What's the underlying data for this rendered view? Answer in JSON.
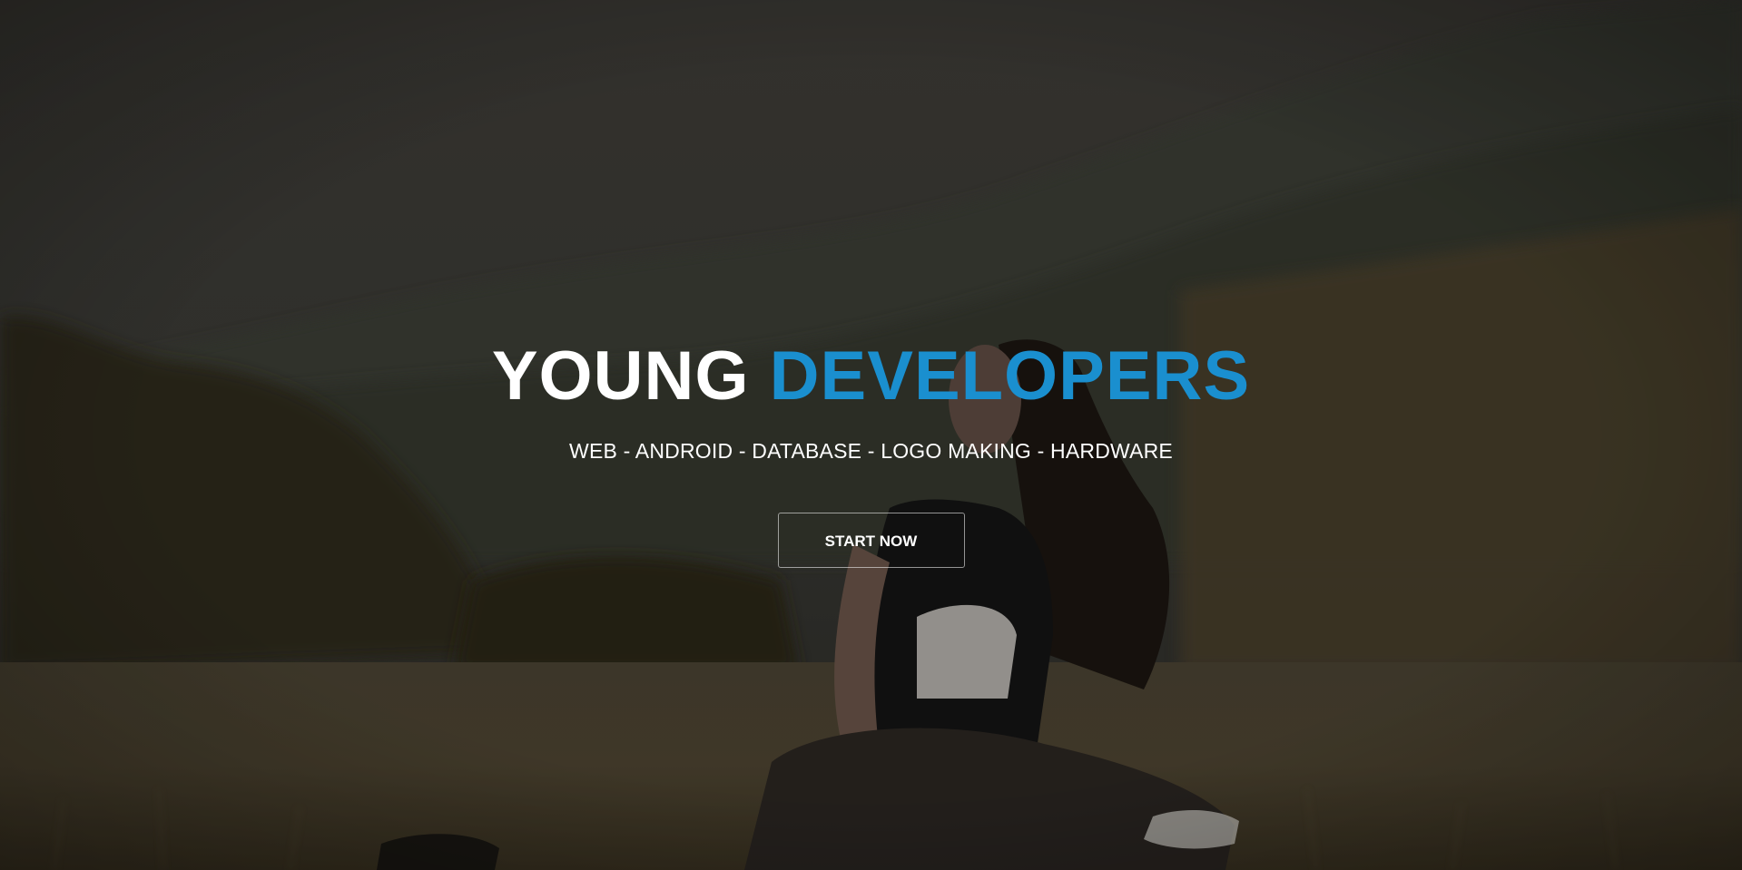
{
  "hero": {
    "title_white": "YOUNG",
    "title_accent": "DEVELOPERS",
    "tagline": "WEB - ANDROID - DATABASE - LOGO MAKING - HARDWARE",
    "cta_label": "START NOW",
    "accent_color": "#1a8fcf",
    "background_image": "woman sitting in grass field with hills"
  }
}
